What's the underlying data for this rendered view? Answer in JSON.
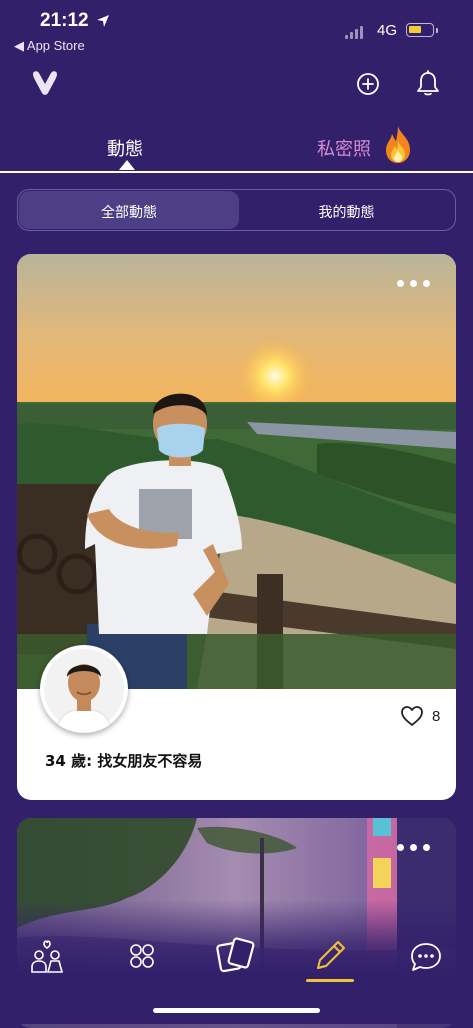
{
  "status_bar": {
    "time": "21:12",
    "back_app": "◀ App Store",
    "network": "4G",
    "battery_color": "#f3cd32"
  },
  "top_bar": {
    "icons": [
      "app-logo",
      "plus-circle-icon",
      "bell-icon"
    ]
  },
  "tabs": [
    {
      "label": "動態",
      "active": true
    },
    {
      "label": "私密照",
      "active": false
    }
  ],
  "segments": [
    {
      "label": "全部動態",
      "active": true
    },
    {
      "label": "我的動態",
      "active": false
    }
  ],
  "post": {
    "likes": "8",
    "caption": "34 歲: 找女朋友不容易"
  },
  "bottom_nav": [
    "couple-icon",
    "grid-icon",
    "cards-icon",
    "pencil-icon",
    "chat-icon"
  ],
  "colors": {
    "background": "#33206b",
    "private_tab": "#d48bd2",
    "accent": "#f0c23b"
  }
}
